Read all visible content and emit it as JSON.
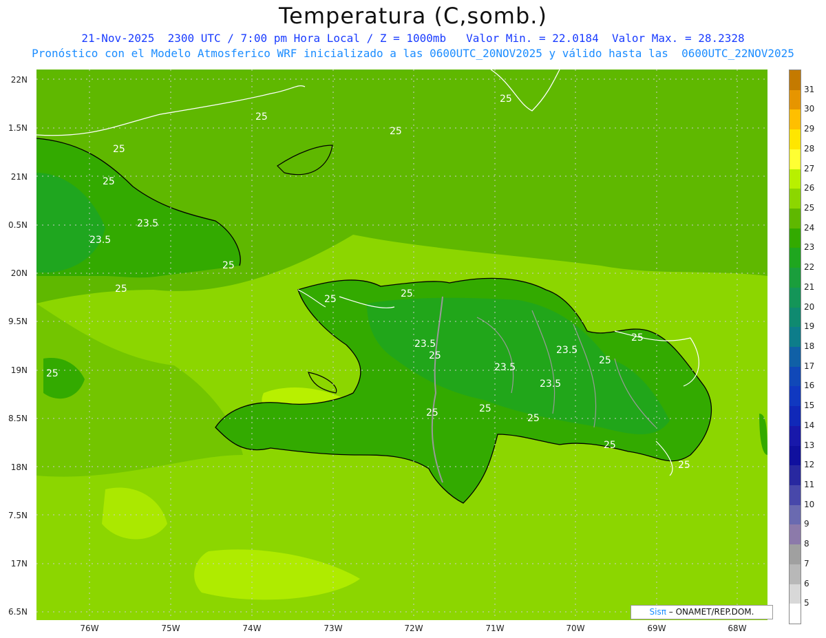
{
  "title": "Temperatura (C,somb.)",
  "subtitle_line1": "21-Nov-2025  2300 UTC / 7:00 pm Hora Local / Z = 1000mb   Valor Min. = 22.0184  Valor Max. = 28.2328",
  "subtitle_line2": "Pronóstico con el Modelo Atmosferico WRF inicializado a las 0600UTC_20NOV2025 y válido hasta las  0600UTC_22NOV2025",
  "lat_labels": [
    "22N",
    "1.5N",
    "21N",
    "0.5N",
    "20N",
    "9.5N",
    "19N",
    "8.5N",
    "18N",
    "7.5N",
    "17N",
    "6.5N"
  ],
  "lon_labels": [
    "76W",
    "75W",
    "74W",
    "73W",
    "72W",
    "71W",
    "70W",
    "69W",
    "68W"
  ],
  "contour_labels": [
    "25",
    "25",
    "25",
    "25",
    "25",
    "23.5",
    "23.5",
    "25",
    "25",
    "25",
    "25",
    "23.5",
    "25",
    "23.5",
    "25",
    "23.5",
    "25",
    "23.5",
    "25",
    "25",
    "25",
    "25",
    "25",
    "25"
  ],
  "colorbar": {
    "labels": [
      "31",
      "30",
      "29",
      "28",
      "27",
      "26",
      "25",
      "24",
      "23",
      "22",
      "21",
      "20",
      "19",
      "18",
      "17",
      "16",
      "15",
      "14",
      "13",
      "12",
      "11",
      "10",
      "9",
      "8",
      "7",
      "6",
      "5"
    ],
    "colors": [
      "#c47a00",
      "#e69500",
      "#ffbf00",
      "#ffe600",
      "#ffff33",
      "#b8f000",
      "#8cd600",
      "#5fb800",
      "#33aa00",
      "#1fa61f",
      "#1a9e3c",
      "#149558",
      "#0f8a70",
      "#0d7d8a",
      "#1060a6",
      "#1048b8",
      "#1038c0",
      "#1028b8",
      "#1818aa",
      "#10109e",
      "#2828a0",
      "#4848aa",
      "#6a6ab0",
      "#8c7aaa",
      "#a0a0a0",
      "#b8b8b8",
      "#d8d8d8"
    ]
  },
  "colors": {
    "ocean_base": "#8cd600",
    "ocean_light": "#b8f000",
    "land_mid": "#5fb800",
    "land_green": "#33aa00",
    "land_deep": "#1fa61f",
    "contour": "#ffffff",
    "title": "#111111",
    "subtitle1": "#1a3cff",
    "subtitle2": "#1a8cff"
  },
  "credit": {
    "sis": "Sis",
    "pi": "π",
    "rest": "– ONAMET/REP.DOM."
  }
}
